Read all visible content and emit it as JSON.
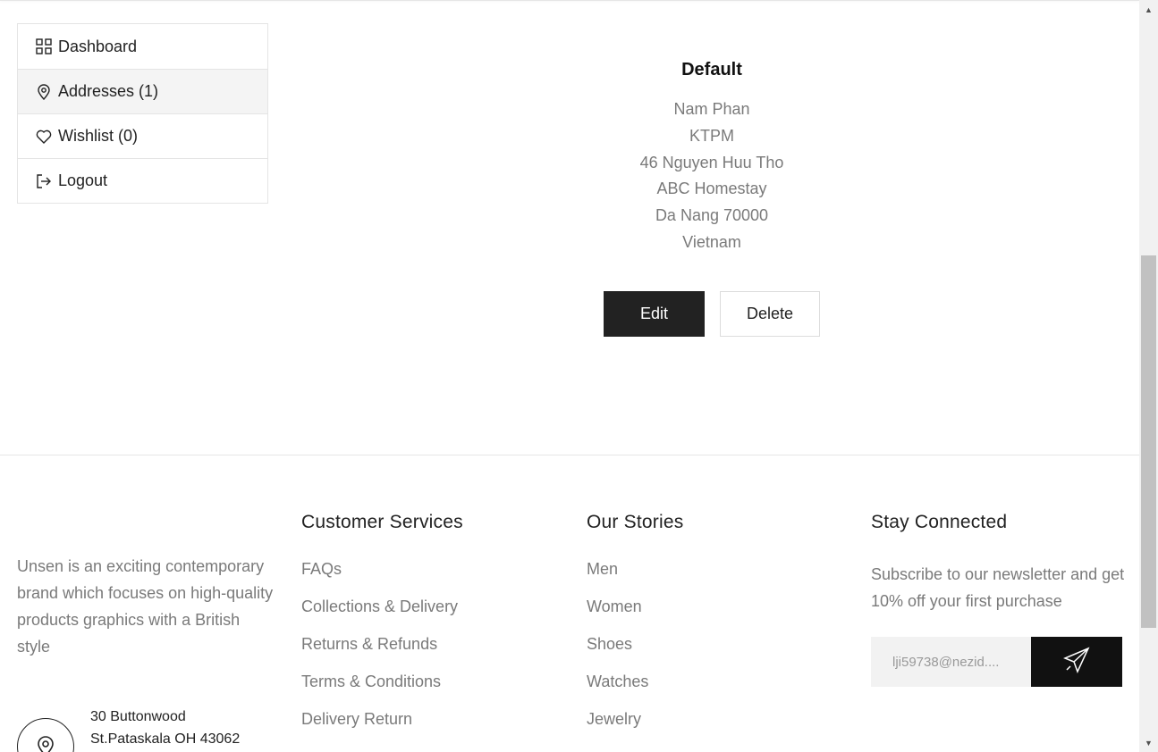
{
  "sidebar": {
    "items": [
      {
        "label": "Dashboard",
        "icon": "grid-icon"
      },
      {
        "label": "Addresses (1)",
        "icon": "map-pin-icon"
      },
      {
        "label": "Wishlist (0)",
        "icon": "heart-icon"
      },
      {
        "label": "Logout",
        "icon": "logout-icon"
      }
    ],
    "active_index": 1
  },
  "address": {
    "title": "Default",
    "lines": [
      "Nam Phan",
      "KTPM",
      "46 Nguyen Huu Tho",
      "ABC Homestay",
      "Da Nang 70000",
      "Vietnam"
    ],
    "edit_label": "Edit",
    "delete_label": "Delete"
  },
  "footer": {
    "about": "Unsen is an exciting contemporary brand which focuses on high-quality products graphics with a British style",
    "address_line1": "30 Buttonwood",
    "address_line2": "St.Pataskala OH 43062",
    "customer_services": {
      "title": "Customer Services",
      "links": [
        "FAQs",
        "Collections & Delivery",
        "Returns & Refunds",
        "Terms & Conditions",
        "Delivery Return"
      ]
    },
    "our_stories": {
      "title": "Our Stories",
      "links": [
        "Men",
        "Women",
        "Shoes",
        "Watches",
        "Jewelry"
      ]
    },
    "stay_connected": {
      "title": "Stay Connected",
      "text": "Subscribe to our newsletter and get 10% off your first purchase",
      "email_value": "lji59738@nezid....",
      "send_icon": "paper-plane-icon"
    }
  },
  "colors": {
    "dark": "#222222",
    "muted": "#7a7a7a",
    "border": "#e4e4e4",
    "active_bg": "#f4f4f4"
  }
}
